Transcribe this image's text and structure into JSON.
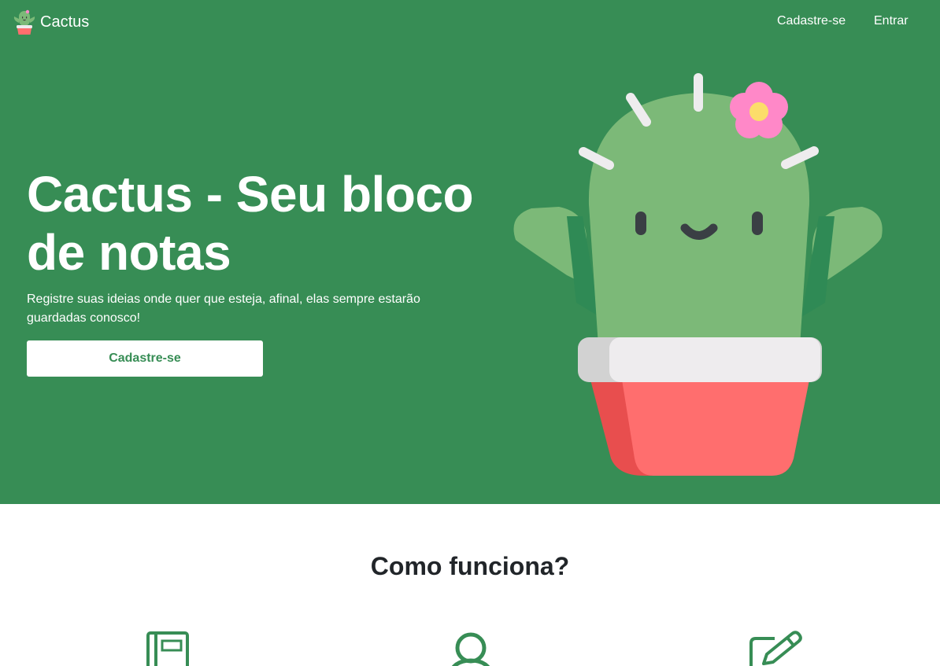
{
  "nav": {
    "brand": "Cactus",
    "links": [
      "Cadastre-se",
      "Entrar"
    ]
  },
  "hero": {
    "title": "Cactus - Seu bloco de notas",
    "subtitle": "Registre suas ideias onde quer que esteja, afinal, elas sempre estarão guardadas conosco!",
    "cta_label": "Cadastre-se"
  },
  "how": {
    "title": "Como funciona?",
    "icons": [
      "notebook-icon",
      "user-icon",
      "pencil-square-icon"
    ]
  },
  "colors": {
    "brand_green": "#378d55",
    "cactus_green": "#7cb978",
    "pot_red": "#ff6e6e",
    "pot_rim": "#eeecee",
    "flower_pink": "#ff88c8",
    "flower_center": "#fcdd6a",
    "text_dark": "#212529"
  }
}
